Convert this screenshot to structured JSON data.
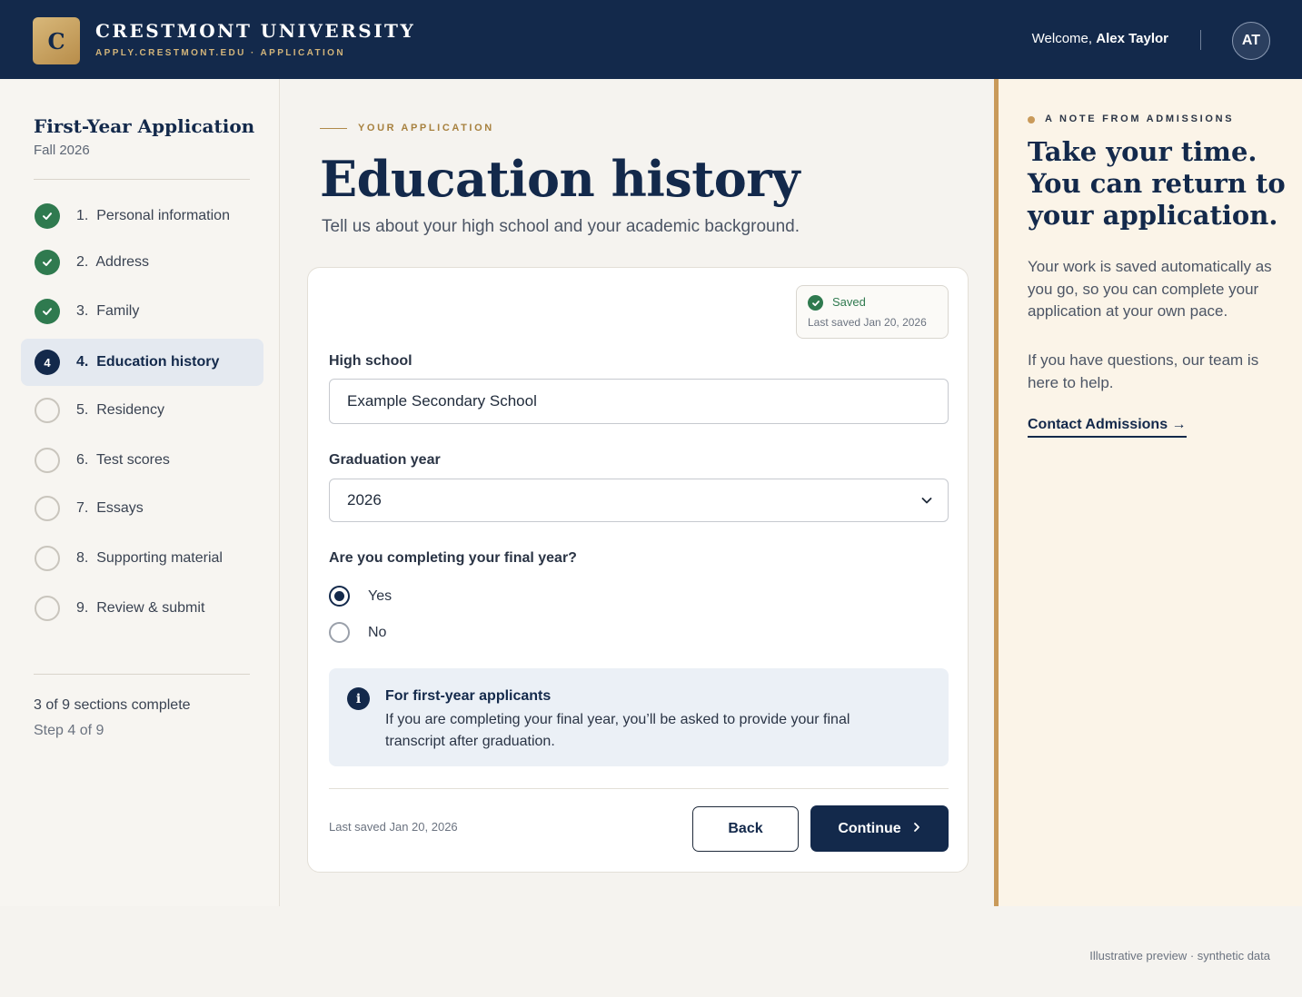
{
  "header": {
    "logo_letter": "C",
    "university_name": "CRESTMONT UNIVERSITY",
    "subtitle": "APPLY.CRESTMONT.EDU · APPLICATION",
    "welcome_prefix": "Welcome,",
    "user_name": "Alex Taylor",
    "avatar_initials": "AT"
  },
  "sidebar": {
    "title": "First-Year Application",
    "term": "Fall 2026",
    "steps": [
      {
        "number": "1.",
        "label": "Personal information",
        "status": "complete"
      },
      {
        "number": "2.",
        "label": "Address",
        "status": "complete"
      },
      {
        "number": "3.",
        "label": "Family",
        "status": "complete"
      },
      {
        "number": "4.",
        "label": "Education history",
        "status": "current",
        "badge": "4"
      },
      {
        "number": "5.",
        "label": "Residency",
        "status": "incomplete"
      },
      {
        "number": "6.",
        "label": "Test scores",
        "status": "incomplete"
      },
      {
        "number": "7.",
        "label": "Essays",
        "status": "incomplete"
      },
      {
        "number": "8.",
        "label": "Supporting material",
        "status": "incomplete"
      },
      {
        "number": "9.",
        "label": "Review & submit",
        "status": "incomplete"
      }
    ],
    "progress_text": "3 of 9 sections complete",
    "step_text": "Step 4 of 9"
  },
  "main": {
    "eyebrow": "YOUR APPLICATION",
    "title": "Education history",
    "subtitle": "Tell us about your high school and your academic background.",
    "saved_status": "Saved",
    "saved_date": "Last saved Jan 20, 2026",
    "high_school": {
      "label": "High school",
      "value": "Example Secondary School"
    },
    "graduation_year": {
      "label": "Graduation year",
      "value": "2026"
    },
    "final_year": {
      "question": "Are you completing your final year?",
      "options": [
        {
          "label": "Yes",
          "checked": true
        },
        {
          "label": "No",
          "checked": false
        }
      ]
    },
    "info": {
      "title": "For first-year applicants",
      "body": "If you are completing your final year, you’ll be asked to provide your final transcript after graduation."
    },
    "footer_saved": "Last saved Jan 20, 2026",
    "back_label": "Back",
    "continue_label": "Continue"
  },
  "note": {
    "eyebrow": "A NOTE FROM ADMISSIONS",
    "title": "Take your time. You can return to your application.",
    "paragraph1": "Your work is saved automatically as you go, so you can complete your application at your own pace.",
    "paragraph2": "If you have questions, our team is here to help.",
    "link_label": "Contact Admissions →"
  },
  "footnote": "Illustrative preview · synthetic data",
  "colors": {
    "navy": "#13294b",
    "gold": "#c99a5a",
    "success": "#2f7a4f",
    "info_bg": "#ebf0f6"
  }
}
